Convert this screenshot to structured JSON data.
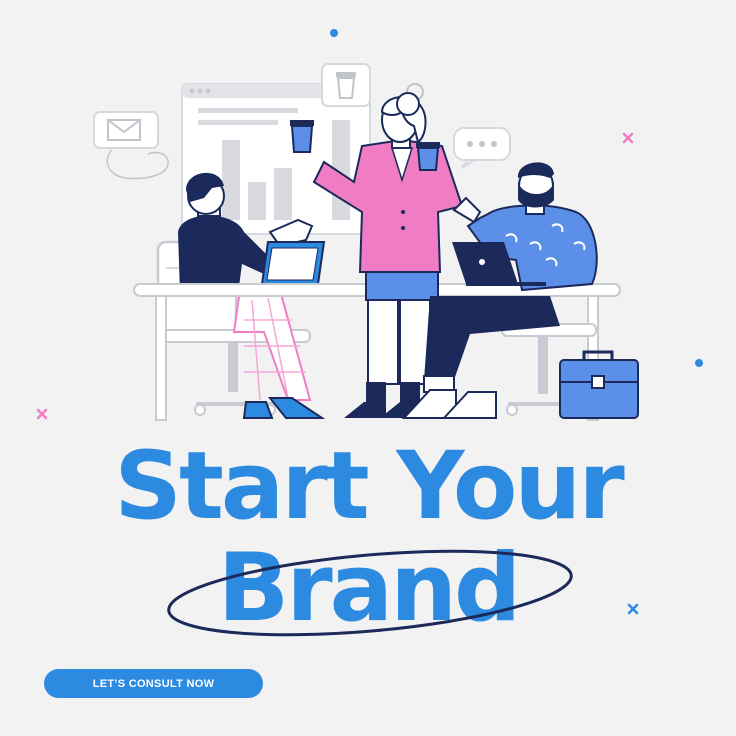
{
  "headline": {
    "line1": "Start Your",
    "line2": "Brand"
  },
  "cta": {
    "label": "LET’S CONSULT NOW"
  },
  "colors": {
    "background": "#f2f2f2",
    "accent_blue": "#2c8ae0",
    "navy": "#1b2a5b",
    "pink": "#f07cc4",
    "light_blue": "#5b8fe8"
  },
  "icons": [
    "envelope-icon",
    "coffee-cup-icon",
    "chat-dots-icon",
    "laptop-icon",
    "briefcase-icon"
  ]
}
